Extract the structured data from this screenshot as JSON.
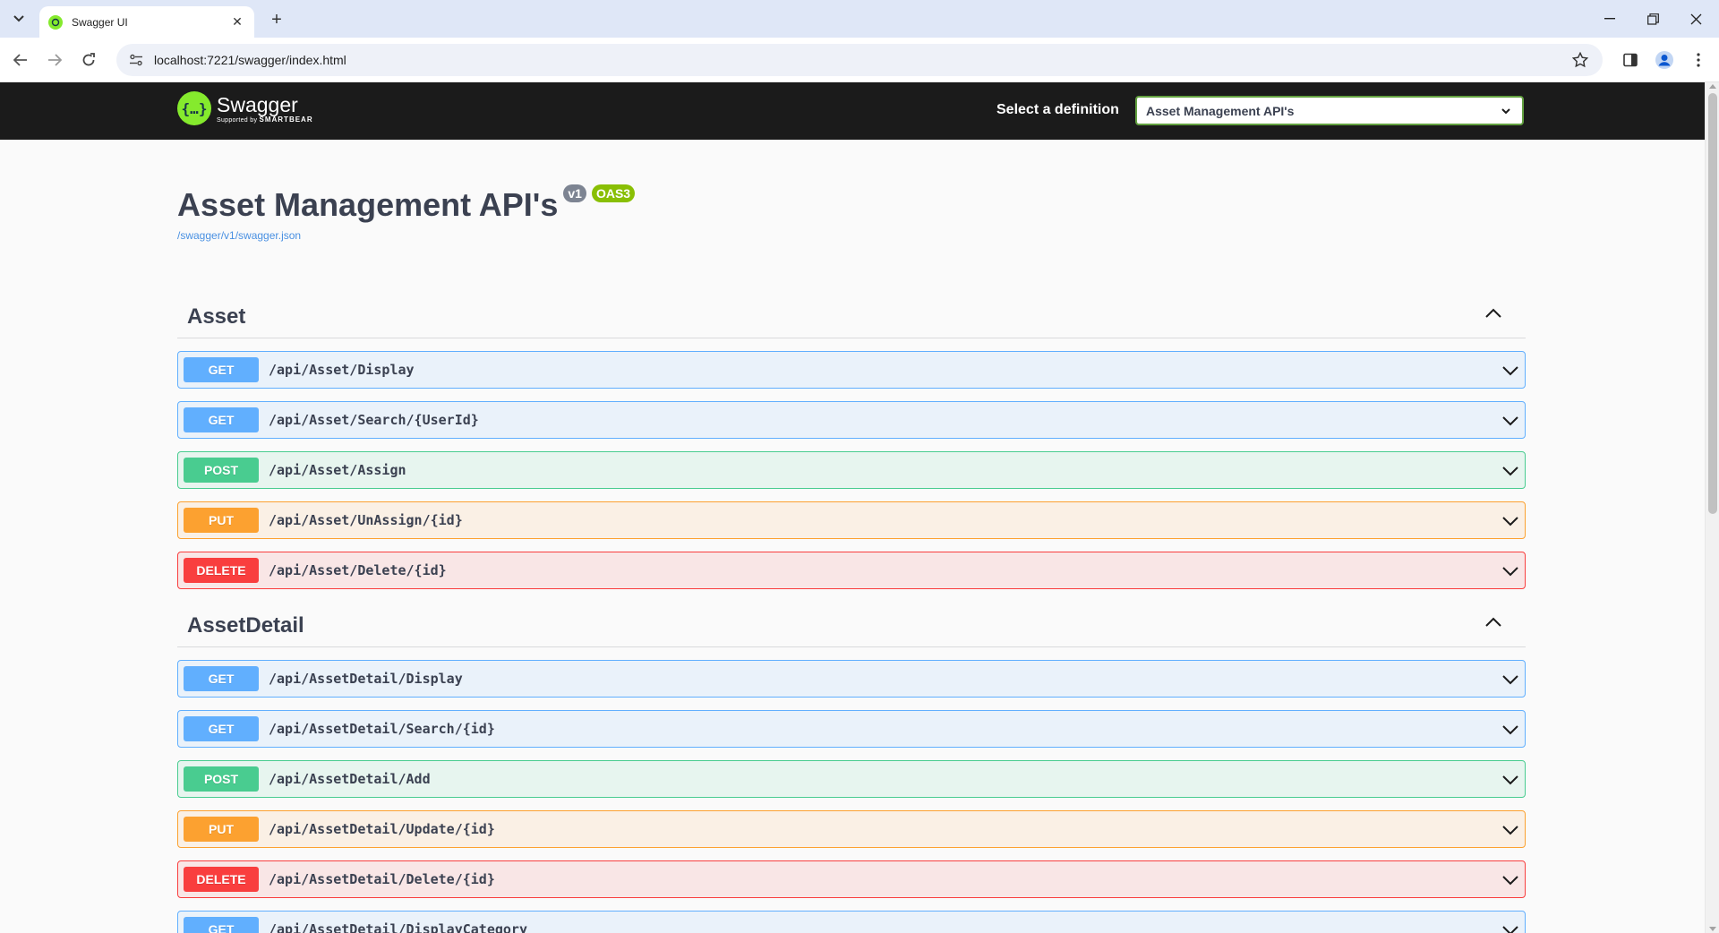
{
  "browser": {
    "tab_title": "Swagger UI",
    "url": "localhost:7221/swagger/index.html"
  },
  "topbar": {
    "logo_name": "Swagger",
    "logo_sub_prefix": "Supported by",
    "logo_sub_brand": "SMARTBEAR",
    "definition_label": "Select a definition",
    "definition_value": "Asset Management API's"
  },
  "info": {
    "title": "Asset Management API's",
    "version": "v1",
    "oas": "OAS3",
    "spec_url": "/swagger/v1/swagger.json"
  },
  "tags": [
    {
      "name": "Asset",
      "operations": [
        {
          "method": "GET",
          "path": "/api/Asset/Display"
        },
        {
          "method": "GET",
          "path": "/api/Asset/Search/{UserId}"
        },
        {
          "method": "POST",
          "path": "/api/Asset/Assign"
        },
        {
          "method": "PUT",
          "path": "/api/Asset/UnAssign/{id}"
        },
        {
          "method": "DELETE",
          "path": "/api/Asset/Delete/{id}"
        }
      ]
    },
    {
      "name": "AssetDetail",
      "operations": [
        {
          "method": "GET",
          "path": "/api/AssetDetail/Display"
        },
        {
          "method": "GET",
          "path": "/api/AssetDetail/Search/{id}"
        },
        {
          "method": "POST",
          "path": "/api/AssetDetail/Add"
        },
        {
          "method": "PUT",
          "path": "/api/AssetDetail/Update/{id}"
        },
        {
          "method": "DELETE",
          "path": "/api/AssetDetail/Delete/{id}"
        },
        {
          "method": "GET",
          "path": "/api/AssetDetail/DisplayCategory"
        }
      ]
    }
  ],
  "colors": {
    "get": "#61affe",
    "post": "#49cc90",
    "put": "#fca130",
    "delete": "#f93e3e",
    "swagger_green": "#85ea2d"
  }
}
